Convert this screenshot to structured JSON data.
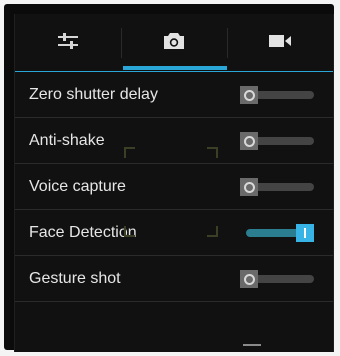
{
  "tabs": [
    {
      "icon": "sliders-icon",
      "active": false
    },
    {
      "icon": "camera-icon",
      "active": true
    },
    {
      "icon": "video-camera-icon",
      "active": false
    }
  ],
  "settings": [
    {
      "label": "Zero shutter delay",
      "enabled": false
    },
    {
      "label": "Anti-shake",
      "enabled": false
    },
    {
      "label": "Voice capture",
      "enabled": false
    },
    {
      "label": "Face Detection",
      "enabled": true
    },
    {
      "label": "Gesture shot",
      "enabled": false
    }
  ],
  "colors": {
    "accent": "#2aa7d6",
    "toggle_on": "#38b3e6",
    "panel_bg": "#111111",
    "text": "#e6e6e6"
  }
}
